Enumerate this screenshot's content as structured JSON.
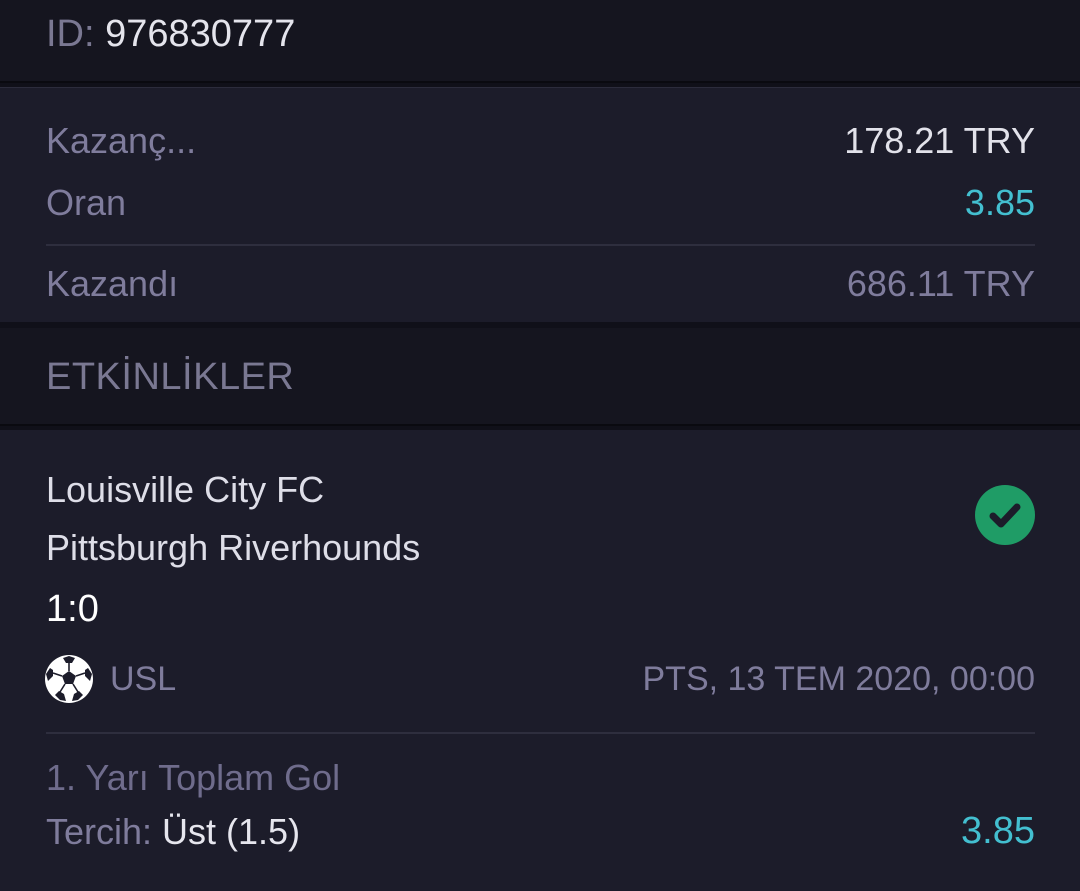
{
  "header": {
    "id_label": "ID:",
    "id_value": "976830777"
  },
  "summary": {
    "stake_label": "Kazanç...",
    "stake_value": "178.21 TRY",
    "odds_label": "Oran",
    "odds_value": "3.85",
    "won_label": "Kazandı",
    "won_value": "686.11 TRY"
  },
  "section": {
    "title": "ETKİNLİKLER"
  },
  "event": {
    "home_team": "Louisville City FC",
    "away_team": "Pittsburgh Riverhounds",
    "score": "1:0",
    "status_icon": "check-circle-icon",
    "sport_icon": "soccer-ball-icon",
    "league": "USL",
    "datetime": "PTS, 13 TEM 2020, 00:00",
    "market": "1. Yarı Toplam Gol",
    "choice_label": "Tercih:",
    "choice_value": "Üst (1.5)",
    "choice_odds": "3.85"
  },
  "colors": {
    "accent_cyan": "#43bfd0",
    "success_green": "#1f9c66",
    "card_bg": "#1c1c2a",
    "header_bg": "#15151f"
  }
}
